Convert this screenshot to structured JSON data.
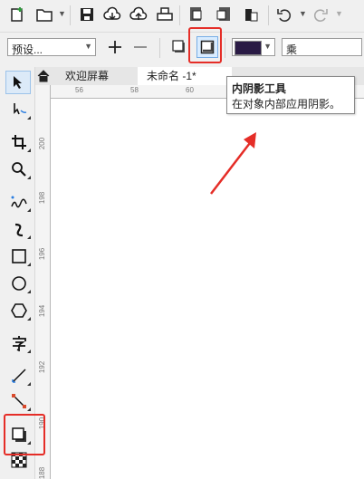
{
  "toolbar": {
    "icons": [
      "new-document-icon",
      "open-folder-icon",
      "save-icon",
      "cloud-download-icon",
      "cloud-upload-icon",
      "print-icon",
      "import-icon",
      "export-icon",
      "publish-icon",
      "undo-icon",
      "redo-icon"
    ]
  },
  "property_bar": {
    "preset_label": "预设...",
    "merge_mode_label": "乘",
    "shadow_color": "#2a1b45"
  },
  "tabs": [
    {
      "label": "欢迎屏幕"
    },
    {
      "label": "未命名 -1*"
    }
  ],
  "ruler": {
    "h_labels": [
      "56",
      "58",
      "60"
    ],
    "v_labels": [
      "200",
      "198",
      "196",
      "194",
      "192",
      "190",
      "188"
    ]
  },
  "tooltip": {
    "title": "内阴影工具",
    "description": "在对象内部应用阴影。"
  },
  "colors": {
    "highlight": "#e52d27",
    "arrow": "#e52d27",
    "active_tab": "#ffffff",
    "toolbar_bg": "#f0f0f0"
  }
}
